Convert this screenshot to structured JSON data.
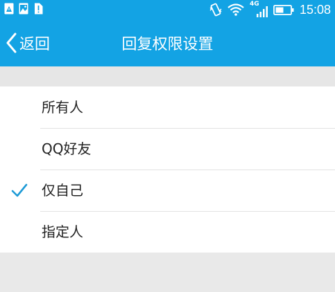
{
  "status_bar": {
    "time": "15:08",
    "network": "4G",
    "icons": [
      "notification-alert-icon",
      "image-notification-icon",
      "sim-alert-icon",
      "vibrate-icon",
      "wifi-icon",
      "signal-icon",
      "battery-icon"
    ]
  },
  "header": {
    "back_label": "返回",
    "title": "回复权限设置"
  },
  "options": [
    {
      "label": "所有人",
      "selected": false
    },
    {
      "label": "QQ好友",
      "selected": false
    },
    {
      "label": "仅自己",
      "selected": true
    },
    {
      "label": "指定人",
      "selected": false
    }
  ],
  "colors": {
    "accent": "#13a3e4",
    "check": "#1d9ad6",
    "background": "#e9e9e9"
  }
}
